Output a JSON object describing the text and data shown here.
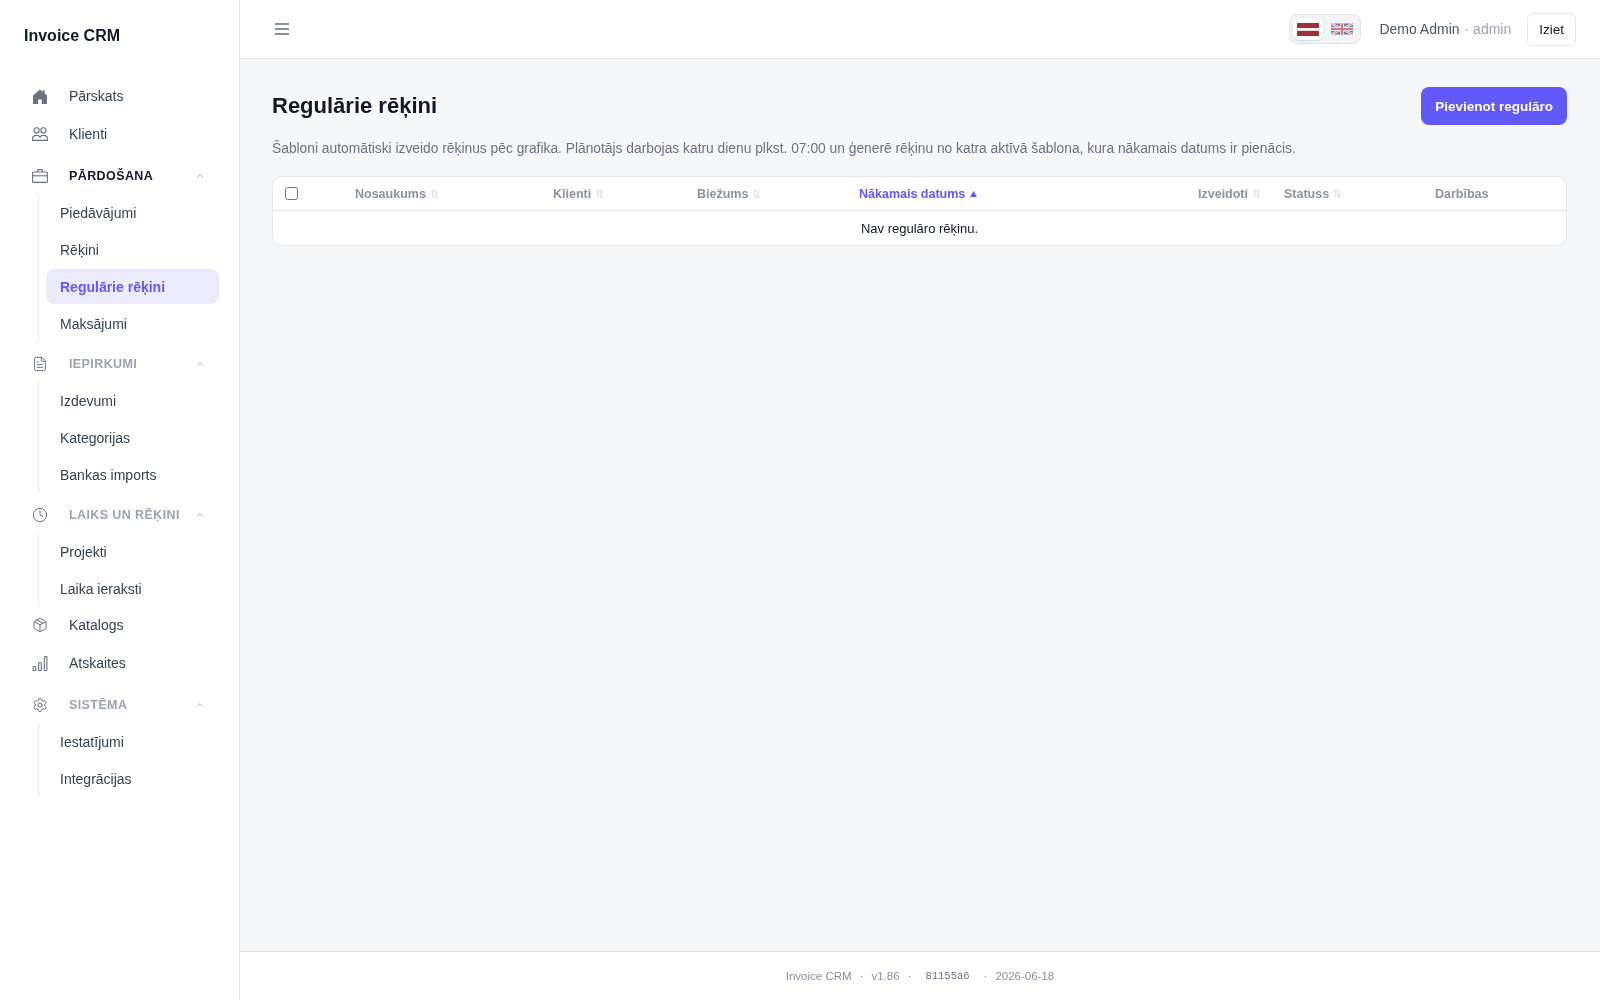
{
  "sidebar": {
    "logo": "Invoice CRM",
    "items": [
      {
        "kind": "link",
        "label": "Pārskats",
        "selected": false
      },
      {
        "kind": "link",
        "label": "Klienti",
        "selected": false
      },
      {
        "kind": "group",
        "label": "PĀRDOŠANA",
        "expanded": true,
        "children": [
          {
            "label": "Piedāvājumi",
            "selected": false
          },
          {
            "label": "Rēķini",
            "selected": false
          },
          {
            "label": "Regulārie rēķini",
            "selected": true
          },
          {
            "label": "Maksājumi",
            "selected": false
          }
        ]
      },
      {
        "kind": "group",
        "label": "IEPIRKUMI",
        "expanded": true,
        "children": [
          {
            "label": "Izdevumi",
            "selected": false
          },
          {
            "label": "Kategorijas",
            "selected": false
          },
          {
            "label": "Bankas imports",
            "selected": false
          }
        ]
      },
      {
        "kind": "group",
        "label": "LAIKS UN RĒĶINI",
        "expanded": true,
        "children": [
          {
            "label": "Projekti",
            "selected": false
          },
          {
            "label": "Laika ieraksti",
            "selected": false
          }
        ]
      },
      {
        "kind": "link",
        "label": "Katalogs",
        "selected": false
      },
      {
        "kind": "link",
        "label": "Atskaites",
        "selected": false
      },
      {
        "kind": "group",
        "label": "SISTĒMA",
        "expanded": true,
        "children": [
          {
            "label": "Iestatījumi",
            "selected": false
          },
          {
            "label": "Integrācijas",
            "selected": false
          }
        ]
      }
    ]
  },
  "topbar": {
    "languages": [
      {
        "kind": "latvia",
        "selected": true
      },
      {
        "kind": "uk",
        "selected": false
      }
    ],
    "user": {
      "name": "Demo Admin",
      "role": "· admin"
    },
    "logout": "Iziet"
  },
  "page": {
    "title": "Regulārie rēķini",
    "primary_action": "Pievienot regulāro",
    "description": "Šabloni automātiski izveido rēķinus pēc grafika. Plānotājs darbojas katru dienu plkst. 07:00 un ģenerē rēķinu no katra aktīvā šablona, kura nākamais datums ir pienācis."
  },
  "table": {
    "select_all": {
      "checked": false
    },
    "columns": [
      {
        "label": "Nosaukums",
        "sortable": true,
        "sorted": false
      },
      {
        "label": "Klienti",
        "sortable": true,
        "sorted": false
      },
      {
        "label": "Biežums",
        "sortable": true,
        "sorted": false
      },
      {
        "label": "Nākamais datums",
        "sortable": true,
        "sorted": true,
        "ascending": true
      },
      {
        "label": "Izveidoti",
        "sortable": true,
        "sorted": false
      },
      {
        "label": "Statuss",
        "sortable": true,
        "sorted": false
      },
      {
        "label": "Darbības",
        "sortable": false
      }
    ],
    "empty_message": "Nav regulāro rēķinu."
  },
  "footer": [
    {
      "kind": "text",
      "text": "Invoice CRM"
    },
    {
      "kind": "separator",
      "text": "·"
    },
    {
      "kind": "text",
      "text": "v1.86"
    },
    {
      "kind": "separator",
      "text": "·"
    },
    {
      "kind": "code",
      "text": "81155a6"
    },
    {
      "kind": "separator",
      "text": "·"
    },
    {
      "kind": "text",
      "text": "2026-06-18"
    }
  ]
}
